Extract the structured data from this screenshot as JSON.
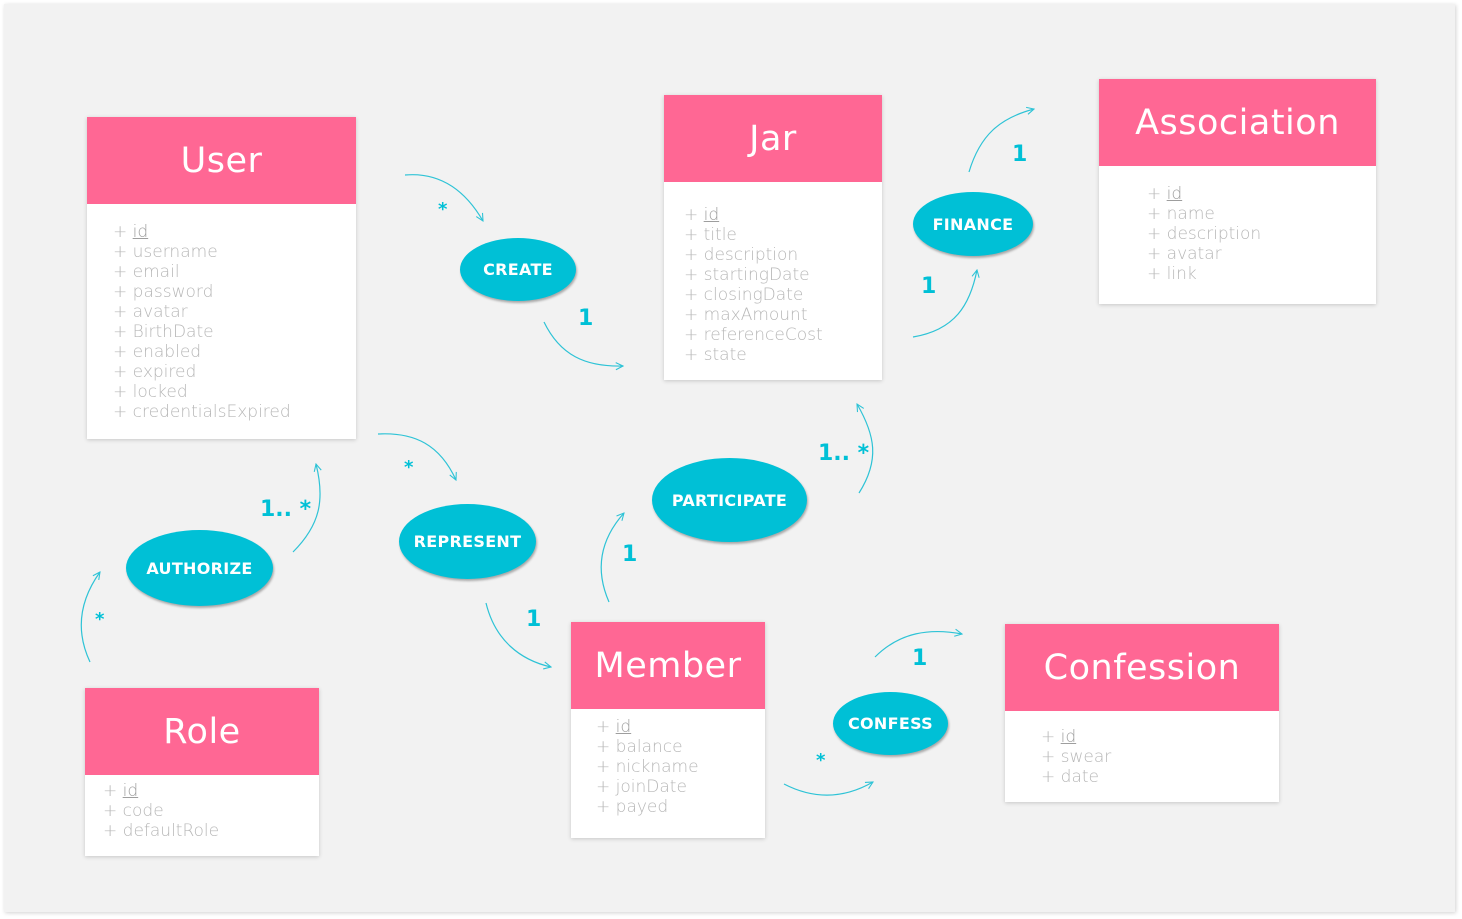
{
  "entities": {
    "user": {
      "title": "User",
      "pk": "id",
      "attributes": [
        "username",
        "email",
        "password",
        "avatar",
        "BirthDate",
        "enabled",
        "expired",
        "locked",
        "credentialsExpired"
      ]
    },
    "jar": {
      "title": "Jar",
      "pk": "id",
      "attributes": [
        "title",
        "description",
        "startingDate",
        "closingDate",
        "maxAmount",
        "referenceCost",
        "state"
      ]
    },
    "association": {
      "title": "Association",
      "pk": "id",
      "attributes": [
        "name",
        "description",
        "avatar",
        "link"
      ]
    },
    "role": {
      "title": "Role",
      "pk": "id",
      "attributes": [
        "code",
        "defaultRole"
      ]
    },
    "member": {
      "title": "Member",
      "pk": "id",
      "attributes": [
        "balance",
        "nickname",
        "joinDate",
        "payed"
      ]
    },
    "confession": {
      "title": "Confession",
      "pk": "id",
      "attributes": [
        "swear",
        "date"
      ]
    }
  },
  "attr_prefix": "+",
  "relationships": {
    "create": {
      "label": "CREATE",
      "from": "User",
      "to": "Jar",
      "from_mult": "*",
      "to_mult": "1"
    },
    "finance": {
      "label": "FINANCE",
      "from": "Jar",
      "to": "Association",
      "from_mult": "1",
      "to_mult": "1"
    },
    "authorize": {
      "label": "AUTHORIZE",
      "from": "Role",
      "to": "User",
      "from_mult": "*",
      "to_mult": "1.. *"
    },
    "represent": {
      "label": "REPRESENT",
      "from": "User",
      "to": "Member",
      "from_mult": "*",
      "to_mult": "1"
    },
    "participate": {
      "label": "PARTICIPATE",
      "from": "Member",
      "to": "Jar",
      "from_mult": "1",
      "to_mult": "1.. *"
    },
    "confess": {
      "label": "CONFESS",
      "from": "Member",
      "to": "Confession",
      "from_mult": "*",
      "to_mult": "1"
    }
  },
  "colors": {
    "entity_header": "#ff6794",
    "relationship": "#00c0d6",
    "attribute_text": "#b7b7b7",
    "background": "#f2f2f2"
  }
}
